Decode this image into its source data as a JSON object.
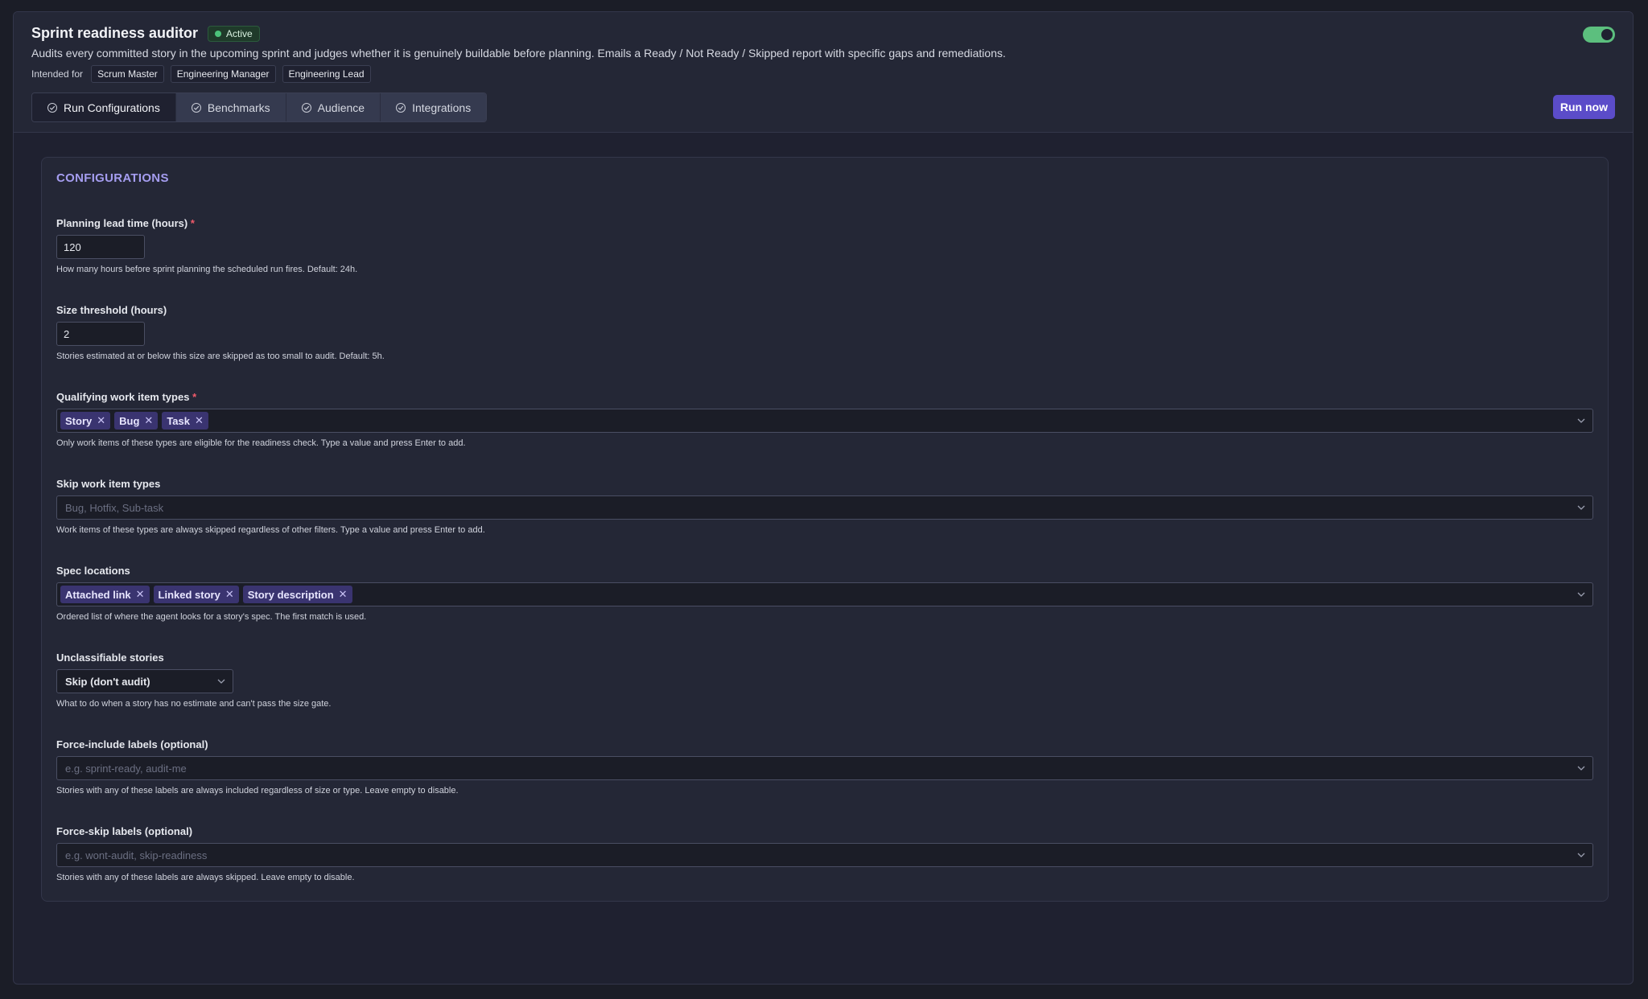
{
  "header": {
    "title": "Sprint readiness auditor",
    "status": "Active",
    "description": "Audits every committed story in the upcoming sprint and judges whether it is genuinely buildable before planning. Emails a Ready / Not Ready / Skipped report with specific gaps and remediations.",
    "intended_label": "Intended for",
    "audiences": [
      "Scrum Master",
      "Engineering Manager",
      "Engineering Lead"
    ],
    "enabled": true
  },
  "tabs": [
    "Run Configurations",
    "Benchmarks",
    "Audience",
    "Integrations"
  ],
  "run_button": "Run now",
  "config": {
    "title": "CONFIGURATIONS",
    "lead_time": {
      "label": "Planning lead time (hours)",
      "required": "*",
      "value": "120",
      "hint": "How many hours before sprint planning the scheduled run fires. Default: 24h."
    },
    "size_threshold": {
      "label": "Size threshold (hours)",
      "value": "2",
      "hint": "Stories estimated at or below this size are skipped as too small to audit. Default: 5h."
    },
    "qualifying_types": {
      "label": "Qualifying work item types",
      "required": "*",
      "chips": [
        "Story",
        "Bug",
        "Task"
      ],
      "hint": "Only work items of these types are eligible for the readiness check. Type a value and press Enter to add."
    },
    "skip_types": {
      "label": "Skip work item types",
      "placeholder": "Bug, Hotfix, Sub-task",
      "hint": "Work items of these types are always skipped regardless of other filters. Type a value and press Enter to add."
    },
    "spec_locations": {
      "label": "Spec locations",
      "chips": [
        "Attached link",
        "Linked story",
        "Story description"
      ],
      "hint": "Ordered list of where the agent looks for a story's spec. The first match is used."
    },
    "unclassifiable": {
      "label": "Unclassifiable stories",
      "value": "Skip (don't audit)",
      "hint": "What to do when a story has no estimate and can't pass the size gate."
    },
    "force_include": {
      "label": "Force-include labels (optional)",
      "placeholder": "e.g. sprint-ready, audit-me",
      "hint": "Stories with any of these labels are always included regardless of size or type. Leave empty to disable."
    },
    "force_skip": {
      "label": "Force-skip labels (optional)",
      "placeholder": "e.g. wont-audit, skip-readiness",
      "hint": "Stories with any of these labels are always skipped. Leave empty to disable."
    }
  }
}
